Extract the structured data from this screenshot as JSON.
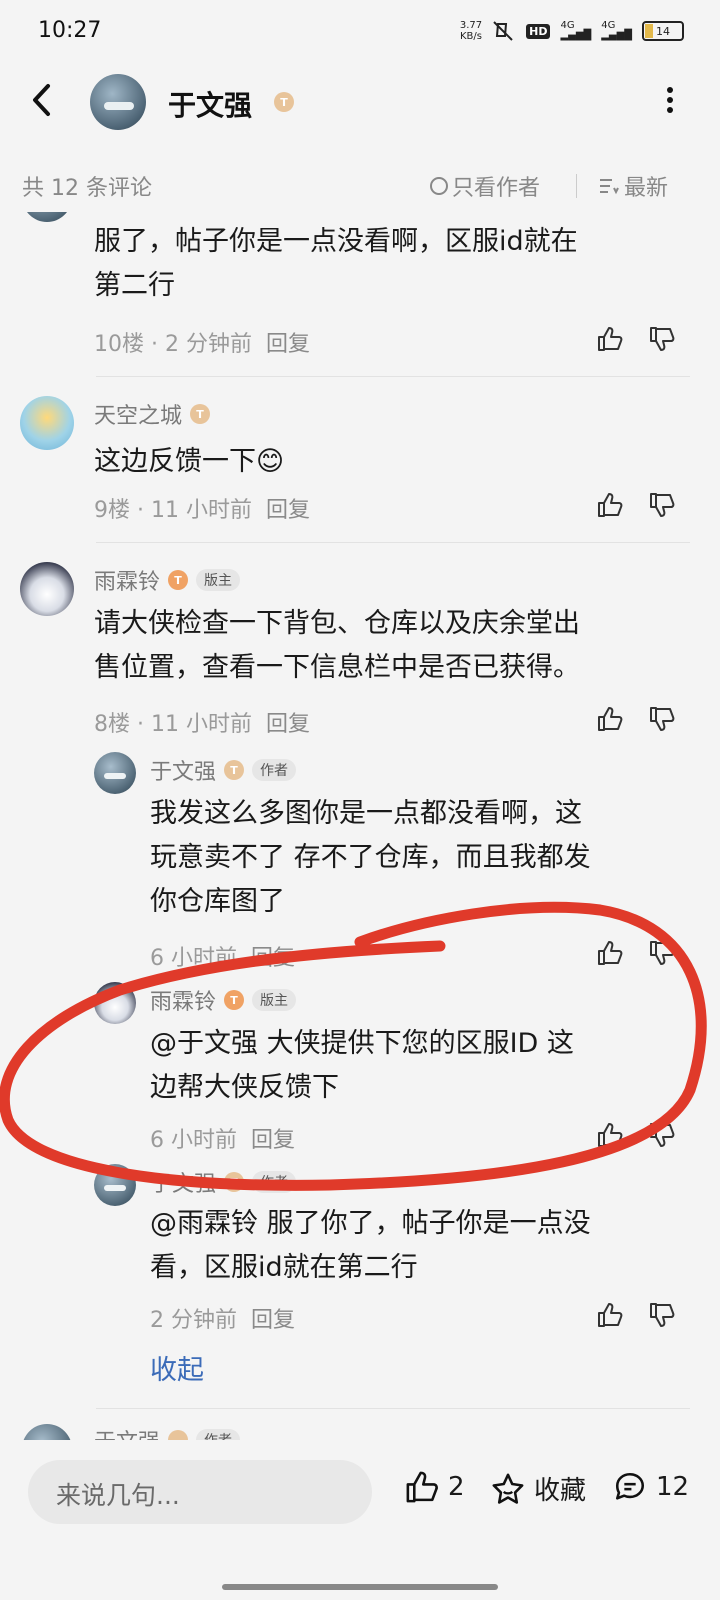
{
  "status": {
    "time": "10:27",
    "net_speed_value": "3.77",
    "net_speed_unit": "KB/s",
    "hd_label": "HD",
    "signal1": "4G",
    "signal2": "4G",
    "battery": "14"
  },
  "header": {
    "title": "于文强",
    "badge": "T"
  },
  "filter": {
    "count_text": "共 12 条评论",
    "only_author": "只看作者",
    "sort": "最新"
  },
  "comments": [
    {
      "text_line1": "服了，帖子你是一点没看啊，区服id就在",
      "text_line2": "第二行",
      "floor": "10楼",
      "time": "2 分钟前",
      "reply": "回复"
    },
    {
      "name": "天空之城",
      "badge": "T",
      "text": "这边反馈一下😊",
      "floor": "9楼",
      "time": "11 小时前",
      "reply": "回复"
    },
    {
      "name": "雨霖铃",
      "badge": "T",
      "role": "版主",
      "text_line1": "请大侠检查一下背包、仓库以及庆余堂出",
      "text_line2": "售位置，查看一下信息栏中是否已获得。",
      "floor": "8楼",
      "time": "11 小时前",
      "reply": "回复"
    }
  ],
  "replies": [
    {
      "name": "于文强",
      "badge": "T",
      "role": "作者",
      "text_line1": "我发这么多图你是一点都没看啊，这",
      "text_line2": "玩意卖不了 存不了仓库，而且我都发",
      "text_line3": "你仓库图了",
      "time": "6 小时前",
      "reply": "回复"
    },
    {
      "name": "雨霖铃",
      "badge": "T",
      "role": "版主",
      "text_line1": "@于文强  大侠提供下您的区服ID 这",
      "text_line2": "边帮大侠反馈下",
      "time": "6 小时前",
      "reply": "回复"
    },
    {
      "name": "于文强",
      "badge": "T",
      "role": "作者",
      "text_line1": "@雨霖铃  服了你了，帖子你是一点没",
      "text_line2": "看，区服id就在第二行",
      "time": "2 分钟前",
      "reply": "回复"
    }
  ],
  "collapse": "收起",
  "partial_next": {
    "name": "于文强",
    "role": "作者"
  },
  "bottom": {
    "input_placeholder": "来说几句...",
    "like_count": "2",
    "favorite": "收藏",
    "comment_count": "12"
  },
  "annotation_color": "#e03a2a"
}
